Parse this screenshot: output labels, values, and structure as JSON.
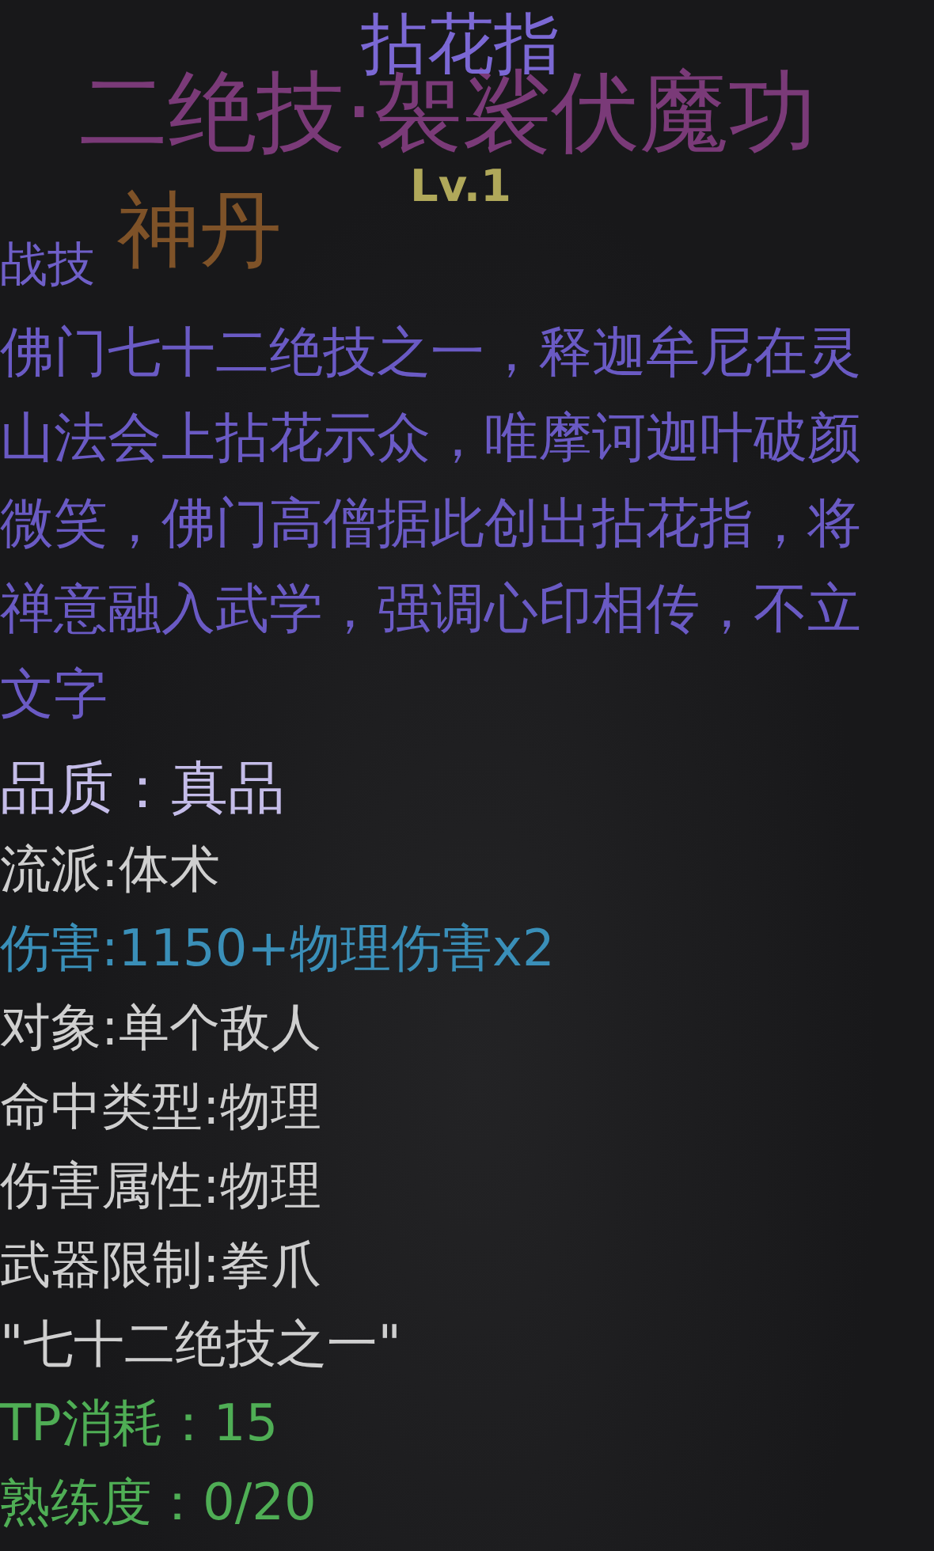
{
  "background_texts": [
    {
      "text": "二绝技·袈裟伏魔功",
      "kind": "skill"
    },
    {
      "text": "神丹",
      "kind": "item"
    }
  ],
  "tooltip": {
    "title": "拈花指",
    "level": "Lv.1",
    "category": "战技",
    "description": "佛门七十二绝技之一，释迦牟尼在灵山法会上拈花示众，唯摩诃迦叶破颜微笑，佛门高僧据此创出拈花指，将禅意融入武学，强调心印相传，不立文字",
    "stats": [
      {
        "text": "品质：真品",
        "kind": "quality"
      },
      {
        "text": "流派:体术",
        "kind": "plain"
      },
      {
        "text": "伤害:1150+物理伤害x2",
        "kind": "damage"
      },
      {
        "text": "对象:单个敌人",
        "kind": "plain"
      },
      {
        "text": "命中类型:物理",
        "kind": "plain"
      },
      {
        "text": "伤害属性:物理",
        "kind": "plain"
      },
      {
        "text": "武器限制:拳爪",
        "kind": "plain"
      },
      {
        "text": "\"七十二绝技之一\"",
        "kind": "plain"
      },
      {
        "text": "TP消耗：15",
        "kind": "cost"
      },
      {
        "text": "熟练度：0/20",
        "kind": "cost"
      }
    ]
  }
}
